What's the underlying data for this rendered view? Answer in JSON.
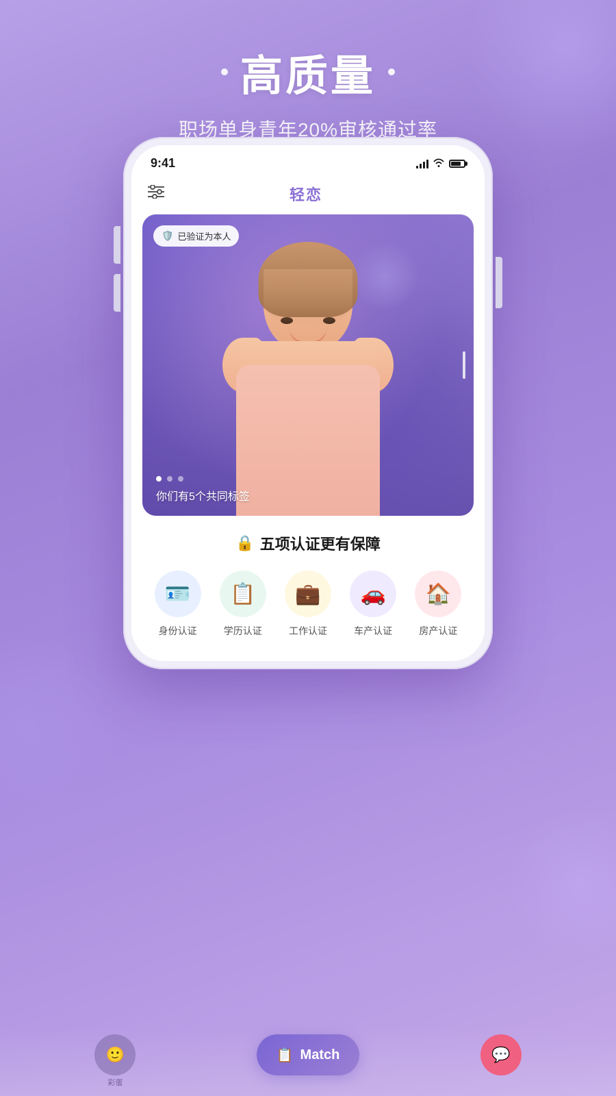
{
  "app": {
    "background": "linear-gradient(160deg, #b8a0e8 0%, #9b7fd4 30%, #a98de0 60%, #c4a8e8 100%)"
  },
  "top_section": {
    "headline": "高质量",
    "subtitle": "职场单身青年20%审核通过率",
    "dot1": "•",
    "dot2": "•"
  },
  "phone": {
    "status_time": "9:41",
    "app_name": "轻恋",
    "verified_label": "已验证为本人",
    "tag_text": "你们有5个共同标签",
    "cert_section_title": "五项认证更有保障",
    "cert_items": [
      {
        "label": "身份认证",
        "icon": "🪪",
        "color_class": "blue"
      },
      {
        "label": "学历认证",
        "icon": "📋",
        "color_class": "green"
      },
      {
        "label": "工作认证",
        "icon": "💼",
        "color_class": "yellow"
      },
      {
        "label": "车产认证",
        "icon": "🚗",
        "color_class": "purple"
      },
      {
        "label": "房产认证",
        "icon": "🏠",
        "color_class": "pink"
      }
    ]
  },
  "bottom_nav": {
    "label1": "彩蛋",
    "label2": "Match",
    "label3": "",
    "match_icon": "📋"
  }
}
